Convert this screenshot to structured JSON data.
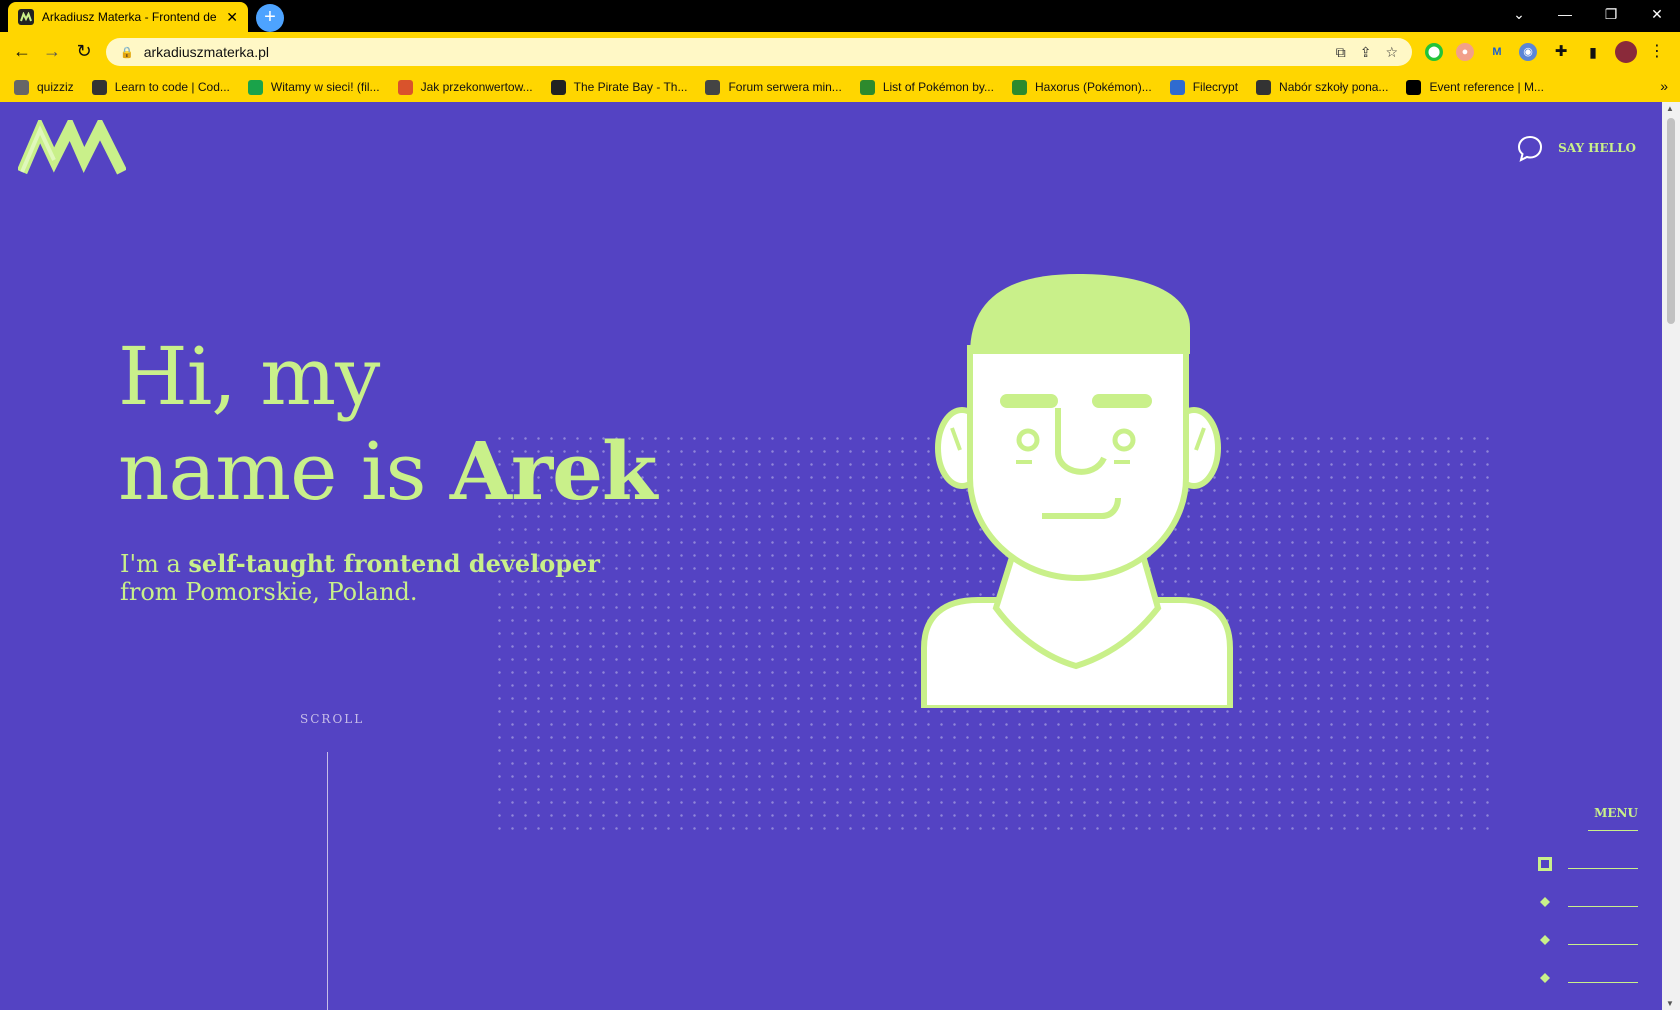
{
  "browser": {
    "tab_title": "Arkadiusz Materka - Frontend de",
    "url": "arkadiuszmaterka.pl",
    "bookmarks": [
      {
        "label": "quizziz",
        "icon": "globe-icon",
        "color": "#666666"
      },
      {
        "label": "Learn to code | Cod...",
        "icon": "codecademy-icon",
        "color": "#333333"
      },
      {
        "label": "Witamy w sieci! (fil...",
        "icon": "shield-icon",
        "color": "#1aa34a"
      },
      {
        "label": "Jak przekonwertow...",
        "icon": "bookmark-icon",
        "color": "#d9532c"
      },
      {
        "label": "The Pirate Bay - Th...",
        "icon": "ship-icon",
        "color": "#222222"
      },
      {
        "label": "Forum serwera min...",
        "icon": "chat-icon",
        "color": "#444444"
      },
      {
        "label": "List of Pokémon by...",
        "icon": "leaf-icon",
        "color": "#2d8a2d"
      },
      {
        "label": "Haxorus (Pokémon)...",
        "icon": "leaf-icon",
        "color": "#2d8a2d"
      },
      {
        "label": "Filecrypt",
        "icon": "shield-icon",
        "color": "#2f6bd0"
      },
      {
        "label": "Nabór szkoły pona...",
        "icon": "v-icon",
        "color": "#333333"
      },
      {
        "label": "Event reference | M...",
        "icon": "mdn-icon",
        "color": "#000000"
      }
    ]
  },
  "header": {
    "say_hello": "SAY HELLO"
  },
  "hero": {
    "line1": "Hi, my",
    "line2_pre": "name is ",
    "line2_name": "Arek",
    "sub_pre": "I'm a ",
    "sub_bold": "self-taught frontend developer",
    "sub_post": " from Pomorskie, Poland."
  },
  "scroll_label": "SCROLL",
  "menu": {
    "label": "MENU",
    "items": [
      {
        "marker": "square"
      },
      {
        "marker": "diamond"
      },
      {
        "marker": "diamond"
      },
      {
        "marker": "diamond"
      }
    ]
  },
  "colors": {
    "background": "#5443c3",
    "accent": "#c9f08a",
    "browser_yellow": "#ffd600"
  }
}
